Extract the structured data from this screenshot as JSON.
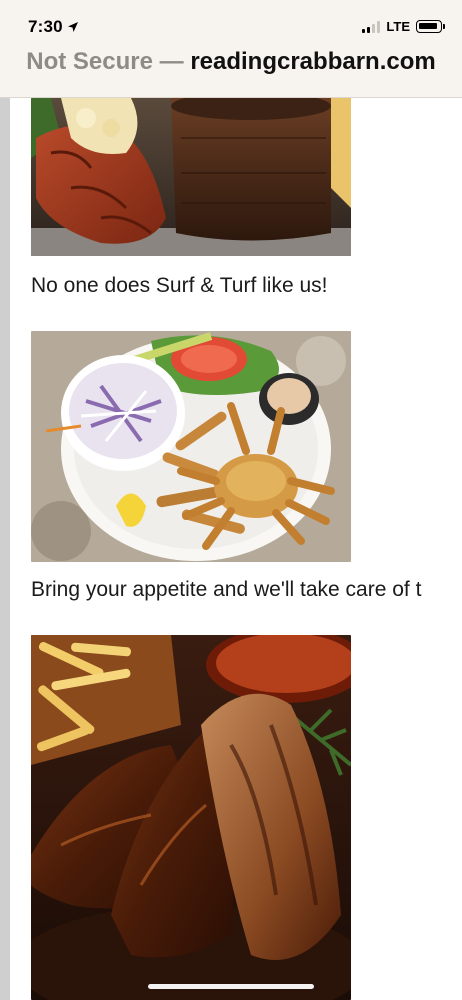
{
  "status_bar": {
    "time": "7:30",
    "network": "LTE"
  },
  "url_bar": {
    "security": "Not Secure",
    "separator": "—",
    "domain": "readingcrabbarn.com"
  },
  "content": {
    "items": [
      {
        "image": "surf-and-turf-photo",
        "caption": "No one does Surf & Turf like us!"
      },
      {
        "image": "crab-platter-photo",
        "caption": "Bring your appetite and we'll take care of t"
      },
      {
        "image": "ribs-photo",
        "caption": ""
      }
    ]
  },
  "colors": {
    "chrome_bg": "#f7f3ee",
    "not_secure": "#8f8a86",
    "left_rule": "#cfcfcf"
  },
  "icons": [
    "location-arrow-icon",
    "signal-icon",
    "battery-icon"
  ]
}
